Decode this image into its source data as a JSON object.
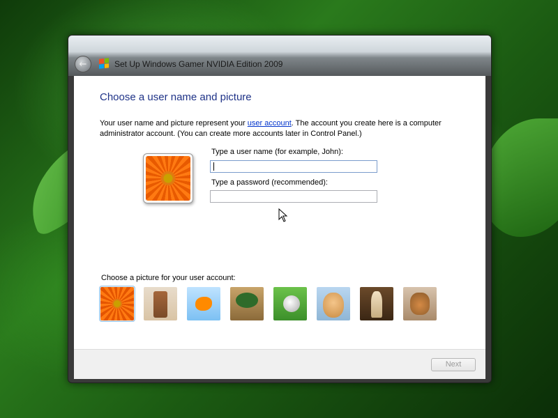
{
  "window": {
    "title": "Set Up Windows Gamer NVIDIA Edition 2009"
  },
  "page": {
    "heading": "Choose a user name and picture",
    "description_before_link": "Your user name and picture represent your ",
    "description_link": "user account",
    "description_after_link": ". The account you create here is a computer administrator account. (You can create more accounts later in Control Panel.)"
  },
  "form": {
    "username_label": "Type a user name (for example, John):",
    "username_value": "",
    "password_label": "Type a password (recommended):",
    "password_value": ""
  },
  "pictures": {
    "label": "Choose a picture for your user account:",
    "items": [
      {
        "icon": "flower-picture",
        "selected": true
      },
      {
        "icon": "robot-picture",
        "selected": false
      },
      {
        "icon": "goldfish-picture",
        "selected": false
      },
      {
        "icon": "bonsai-picture",
        "selected": false
      },
      {
        "icon": "soccer-ball-picture",
        "selected": false
      },
      {
        "icon": "puppy-picture",
        "selected": false
      },
      {
        "icon": "chess-picture",
        "selected": false
      },
      {
        "icon": "kitten-picture",
        "selected": false
      }
    ]
  },
  "footer": {
    "next_label": "Next",
    "next_enabled": false
  }
}
